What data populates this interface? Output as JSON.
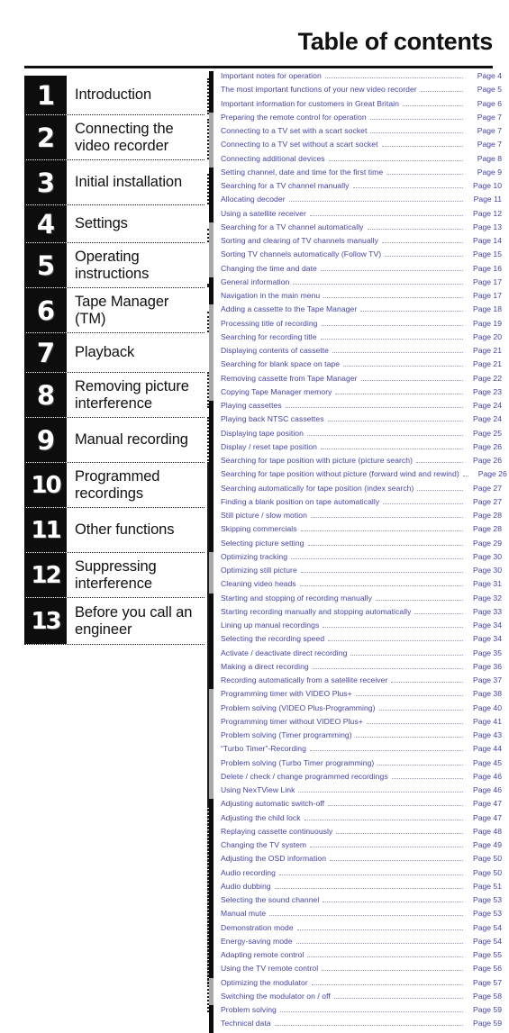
{
  "header": {
    "title": "Table of contents"
  },
  "chapters": [
    {
      "number": "1",
      "label": "Introduction"
    },
    {
      "number": "2",
      "label": "Connecting the video recorder"
    },
    {
      "number": "3",
      "label": "Initial installation"
    },
    {
      "number": "4",
      "label": "Settings"
    },
    {
      "number": "5",
      "label": "Operating instructions"
    },
    {
      "number": "6",
      "label": "Tape Manager (TM)"
    },
    {
      "number": "7",
      "label": "Playback"
    },
    {
      "number": "8",
      "label": "Removing picture interference"
    },
    {
      "number": "9",
      "label": "Manual recording"
    },
    {
      "number": "10",
      "label": "Programmed recordings"
    },
    {
      "number": "11",
      "label": "Other functions"
    },
    {
      "number": "12",
      "label": "Suppressing interference"
    },
    {
      "number": "13",
      "label": "Before you call an engineer"
    }
  ],
  "toc": [
    {
      "title": "Important notes for operation",
      "page": "Page 4",
      "group": 1
    },
    {
      "title": "The most important functions of your new video recorder",
      "page": "Page 5",
      "group": 1
    },
    {
      "title": "Important information for customers in Great Britain",
      "page": "Page 6",
      "group": 1
    },
    {
      "title": "Preparing the remote control for operation",
      "page": "Page 7",
      "group": 2
    },
    {
      "title": "Connecting to a TV set with a scart socket",
      "page": "Page 7",
      "group": 2
    },
    {
      "title": "Connecting to a TV set without a scart socket",
      "page": "Page 7",
      "group": 2
    },
    {
      "title": "Connecting additional devices",
      "page": "Page 8",
      "group": 2
    },
    {
      "title": "Setting channel, date and time for the first time",
      "page": "Page 9",
      "group": 3
    },
    {
      "title": "Searching for a TV channel manually",
      "page": "Page 10",
      "group": 3
    },
    {
      "title": "Allocating decoder",
      "page": "Page 11",
      "group": 3
    },
    {
      "title": "Using a satellite receiver",
      "page": "Page 12",
      "group": 3
    },
    {
      "title": "Searching for a TV channel automatically",
      "page": "Page 13",
      "group": 4
    },
    {
      "title": "Sorting and clearing of TV channels manually",
      "page": "Page 14",
      "group": 4
    },
    {
      "title": "Sorting TV channels automatically (Follow TV)",
      "page": "Page 15",
      "group": 4
    },
    {
      "title": "Changing the time and date",
      "page": "Page 16",
      "group": 4
    },
    {
      "title": "General information",
      "page": "Page 17",
      "group": 5
    },
    {
      "title": "Navigation in the main menu",
      "page": "Page 17",
      "group": 5
    },
    {
      "title": "Adding a cassette to the Tape Manager",
      "page": "Page 18",
      "group": 6
    },
    {
      "title": "Processing title of recording",
      "page": "Page 19",
      "group": 6
    },
    {
      "title": "Searching for recording title",
      "page": "Page 20",
      "group": 6
    },
    {
      "title": "Displaying contents of cassette",
      "page": "Page 21",
      "group": 6
    },
    {
      "title": "Searching for blank space on tape",
      "page": "Page 21",
      "group": 6
    },
    {
      "title": "Removing cassette from Tape Manager",
      "page": "Page 22",
      "group": 6
    },
    {
      "title": "Copying Tape Manager memory",
      "page": "Page 23",
      "group": 6
    },
    {
      "title": "Playing cassettes",
      "page": "Page 24",
      "group": 7
    },
    {
      "title": "Playing back NTSC cassettes",
      "page": "Page 24",
      "group": 7
    },
    {
      "title": "Displaying tape position",
      "page": "Page 25",
      "group": 7
    },
    {
      "title": "Display / reset tape position",
      "page": "Page 26",
      "group": 7
    },
    {
      "title": "Searching for tape position with picture (picture search)",
      "page": "Page 26",
      "group": 7
    },
    {
      "title": "Searching for tape position without picture (forward wind and rewind)",
      "page": "Page 26",
      "group": 7
    },
    {
      "title": "Searching automatically for tape position (index search)",
      "page": "Page 27",
      "group": 7
    },
    {
      "title": "Finding a blank position on tape automatically",
      "page": "Page 27",
      "group": 7
    },
    {
      "title": "Still picture /  slow motion",
      "page": "Page 28",
      "group": 7
    },
    {
      "title": "Skipping commercials",
      "page": "Page 28",
      "group": 7
    },
    {
      "title": "Selecting picture setting",
      "page": "Page 29",
      "group": 7
    },
    {
      "title": "Optimizing tracking",
      "page": "Page 30",
      "group": 8
    },
    {
      "title": "Optimizing still picture",
      "page": "Page 30",
      "group": 8
    },
    {
      "title": "Cleaning video heads",
      "page": "Page 31",
      "group": 8
    },
    {
      "title": "Starting and stopping of recording manually",
      "page": "Page 32",
      "group": 9
    },
    {
      "title": "Starting recording manually and stopping automatically",
      "page": "Page 33",
      "group": 9
    },
    {
      "title": "Lining up manual recordings",
      "page": "Page 34",
      "group": 9
    },
    {
      "title": "Selecting the recording speed",
      "page": "Page 34",
      "group": 9
    },
    {
      "title": "Activate / deactivate direct recording",
      "page": "Page 35",
      "group": 9
    },
    {
      "title": "Making a direct recording",
      "page": "Page 36",
      "group": 9
    },
    {
      "title": "Recording automatically from a satellite receiver",
      "page": "Page 37",
      "group": 9
    },
    {
      "title": "Programming timer with VIDEO Plus+",
      "page": "Page 38",
      "group": 10
    },
    {
      "title": "Problem solving (VIDEO Plus-Programming)",
      "page": "Page 40",
      "group": 10
    },
    {
      "title": "Programming timer without VIDEO Plus+",
      "page": "Page 41",
      "group": 10
    },
    {
      "title": "Problem solving (Timer programming)",
      "page": "Page 43",
      "group": 10
    },
    {
      "title": "“Turbo Timer”-Recording",
      "page": "Page 44",
      "group": 10
    },
    {
      "title": "Problem solving (Turbo Timer programming)",
      "page": "Page 45",
      "group": 10
    },
    {
      "title": "Delete / check / change programmed recordings",
      "page": "Page 46",
      "group": 10
    },
    {
      "title": "Using NexTView Link",
      "page": "Page 46",
      "group": 10
    },
    {
      "title": "Adjusting automatic switch-off",
      "page": "Page 47",
      "group": 11
    },
    {
      "title": "Adjusting the child lock",
      "page": "Page 47",
      "group": 11
    },
    {
      "title": "Replaying cassette continuously",
      "page": "Page 48",
      "group": 11
    },
    {
      "title": "Changing the TV system",
      "page": "Page 49",
      "group": 11
    },
    {
      "title": "Adjusting the OSD information",
      "page": "Page 50",
      "group": 11
    },
    {
      "title": "Audio recording",
      "page": "Page 50",
      "group": 11
    },
    {
      "title": "Audio dubbing",
      "page": "Page 51",
      "group": 11
    },
    {
      "title": "Selecting the sound channel",
      "page": "Page 53",
      "group": 11
    },
    {
      "title": "Manual mute",
      "page": "Page 53",
      "group": 11
    },
    {
      "title": "Demonstration mode",
      "page": "Page 54",
      "group": 11
    },
    {
      "title": "Energy-saving mode",
      "page": "Page 54",
      "group": 11
    },
    {
      "title": "Adapting remote control",
      "page": "Page 55",
      "group": 11
    },
    {
      "title": "Using the TV remote control",
      "page": "Page 56",
      "group": 11
    },
    {
      "title": "Optimizing the modulator",
      "page": "Page 57",
      "group": 12
    },
    {
      "title": "Switching the modulator on / off",
      "page": "Page 58",
      "group": 12
    },
    {
      "title": "Problem solving",
      "page": "Page 59",
      "group": 13
    },
    {
      "title": "Technical data",
      "page": "Page 59",
      "group": 13
    }
  ]
}
